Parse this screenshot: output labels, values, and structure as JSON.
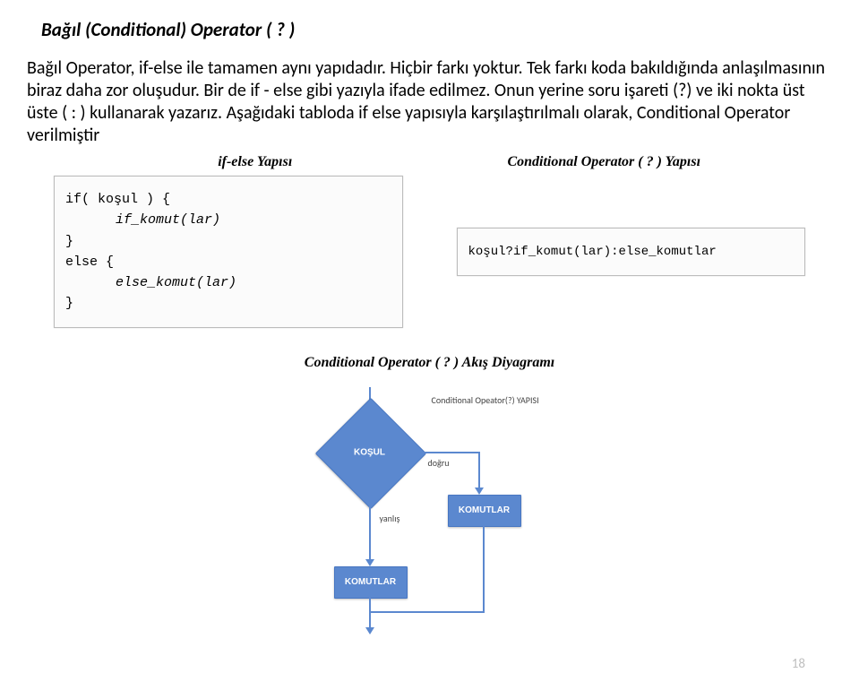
{
  "title": "Bağıl (Conditional) Operator ( ? )",
  "paragraph": "Bağıl Operator, if-else ile tamamen aynı yapıdadır. Hiçbir farkı yoktur. Tek farkı koda bakıldığında anlaşılmasının biraz daha zor oluşudur. Bir de if - else gibi yazıyla ifade edilmez. Onun yerine soru işareti (?) ve iki nokta üst üste ( : ) kullanarak yazarız. Aşağıdaki tabloda if else yapısıyla karşılaştırılmalı olarak, Conditional Operator verilmiştir",
  "headers": {
    "left": "if-else Yapısı",
    "right": "Conditional Operator ( ? ) Yapısı"
  },
  "code_left": {
    "l1": "if( koşul ) {",
    "l2": "if_komut(lar)",
    "l3": "}",
    "l4": "else {",
    "l5": "else_komut(lar)",
    "l6": "}"
  },
  "code_right": "koşul?if_komut(lar):else_komutlar",
  "diagram_title": "Conditional Operator ( ? ) Akış Diyagramı",
  "flow": {
    "caption": "Conditional Opeator(?) YAPISI",
    "kosul": "KOŞUL",
    "komutlar1": "KOMUTLAR",
    "komutlar2": "KOMUTLAR",
    "dogru": "doğru",
    "yanlis": "yanlış"
  },
  "page_number": "18"
}
